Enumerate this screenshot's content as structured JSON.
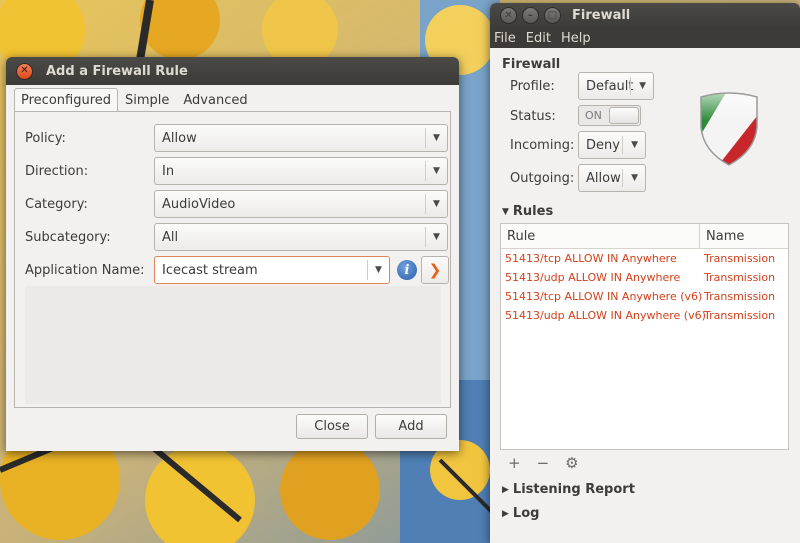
{
  "dialog": {
    "title": "Add a Firewall Rule",
    "tabs": [
      "Preconfigured",
      "Simple",
      "Advanced"
    ],
    "fields": {
      "policy_label": "Policy:",
      "policy_value": "Allow",
      "direction_label": "Direction:",
      "direction_value": "In",
      "category_label": "Category:",
      "category_value": "AudioVideo",
      "subcategory_label": "Subcategory:",
      "subcategory_value": "All",
      "appname_label": "Application Name:",
      "appname_value": "Icecast stream"
    },
    "buttons": {
      "close": "Close",
      "add": "Add"
    }
  },
  "firewall": {
    "title": "Firewall",
    "menu": [
      "File",
      "Edit",
      "Help"
    ],
    "heading": "Firewall",
    "profile_label": "Profile:",
    "profile_value": "Default",
    "status_label": "Status:",
    "status_value": "ON",
    "incoming_label": "Incoming:",
    "incoming_value": "Deny",
    "outgoing_label": "Outgoing:",
    "outgoing_value": "Allow",
    "rules_title": "Rules",
    "rules_columns": [
      "Rule",
      "Name"
    ],
    "rules": [
      {
        "rule": "51413/tcp ALLOW IN Anywhere",
        "name": "Transmission"
      },
      {
        "rule": "51413/udp ALLOW IN Anywhere",
        "name": "Transmission"
      },
      {
        "rule": "51413/tcp ALLOW IN Anywhere (v6)",
        "name": "Transmission"
      },
      {
        "rule": "51413/udp ALLOW IN Anywhere (v6)",
        "name": "Transmission"
      }
    ],
    "listening_title": "Listening Report",
    "log_title": "Log"
  },
  "colors": {
    "rule_text": "#d2401a",
    "titlebar": "#3c3b37",
    "close_button": "#df4a16",
    "shield_green": "#2e8b3a",
    "shield_red": "#c7262b"
  },
  "icons": [
    "close-icon",
    "minimize-icon",
    "maximize-icon",
    "info-icon",
    "chevron-right-icon",
    "shield-icon",
    "add-icon",
    "remove-icon",
    "gear-icon",
    "expander-icon"
  ]
}
